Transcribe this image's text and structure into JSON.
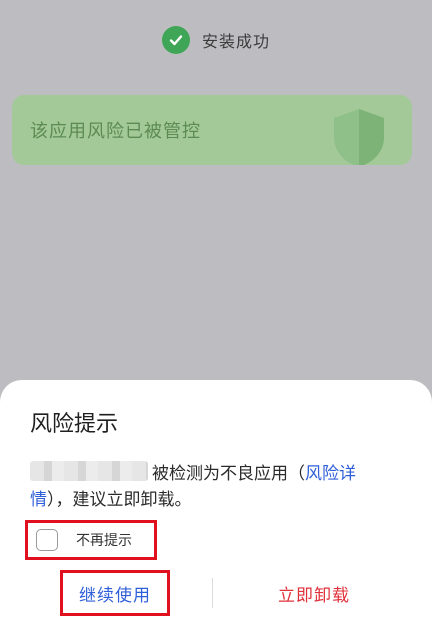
{
  "status": {
    "text": "安装成功",
    "icon": "check-icon"
  },
  "banner": {
    "text": "该应用风险已被管控",
    "icon": "shield-icon"
  },
  "dialog": {
    "title": "风险提示",
    "message_part1": "被检测为不良应用（",
    "link_text_1": "风险详",
    "link_text_2": "情",
    "message_part2": "），建议立即卸载。",
    "checkbox_label": "不再提示",
    "continue_button": "继续使用",
    "uninstall_button": "立即卸载"
  },
  "colors": {
    "accent_link": "#2f5fd8",
    "danger": "#e0303a",
    "success": "#3fa657",
    "highlight_box": "#e1101f"
  }
}
